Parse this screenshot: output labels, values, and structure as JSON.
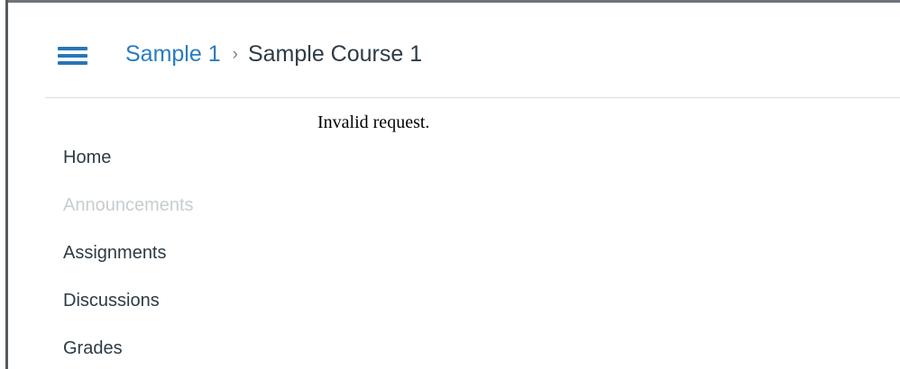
{
  "header": {
    "menu_icon": "hamburger-menu-icon",
    "breadcrumb": {
      "account": "Sample 1",
      "separator": "›",
      "course": "Sample Course 1"
    }
  },
  "main": {
    "message": "Invalid request."
  },
  "course_nav": {
    "items": [
      {
        "label": "Home",
        "disabled": false
      },
      {
        "label": "Announcements",
        "disabled": true
      },
      {
        "label": "Assignments",
        "disabled": false
      },
      {
        "label": "Discussions",
        "disabled": false
      },
      {
        "label": "Grades",
        "disabled": false
      }
    ]
  },
  "colors": {
    "accent": "#2a7cc0",
    "text": "#2d3b45",
    "disabled_text": "#c7cdd1",
    "divider": "#d9dde1"
  }
}
